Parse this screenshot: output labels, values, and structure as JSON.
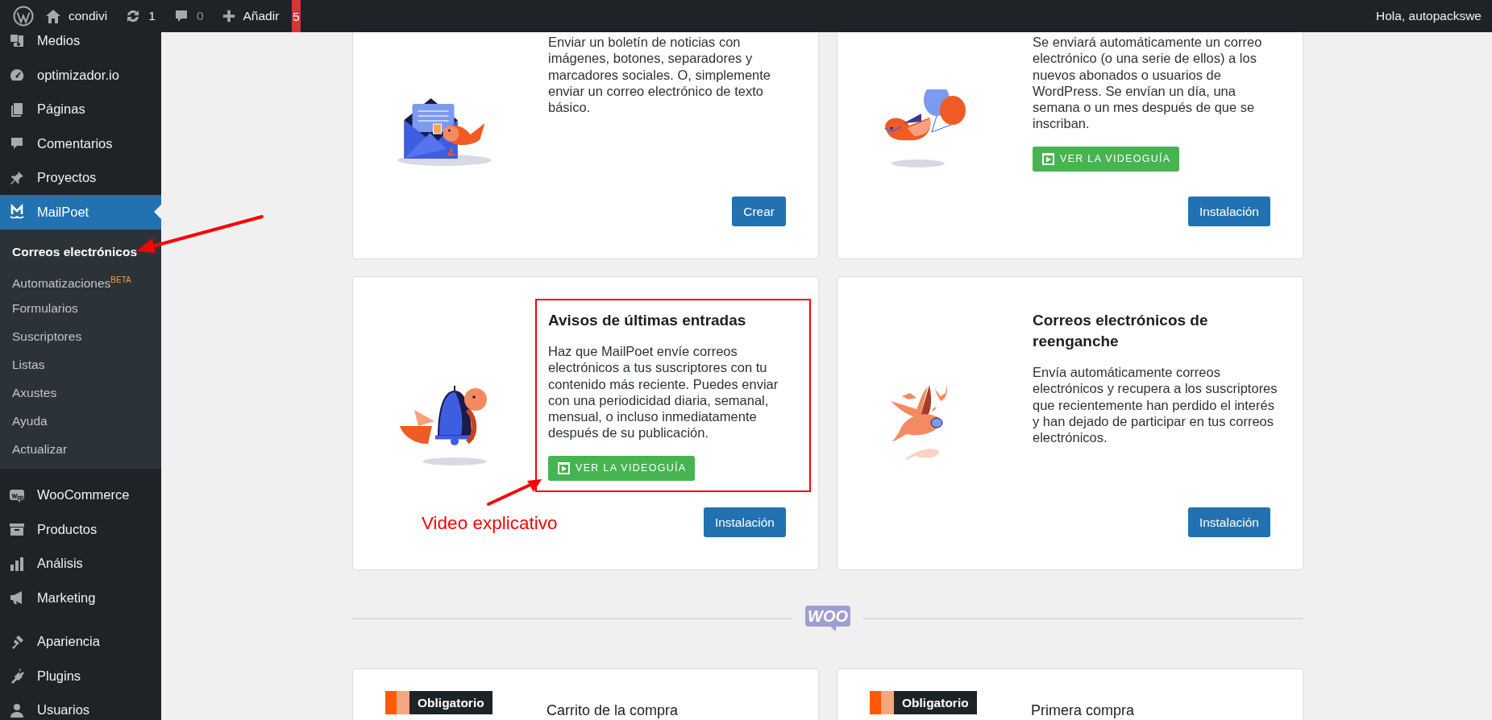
{
  "admin_bar": {
    "site_name": "condivi",
    "updates": "1",
    "comments": "0",
    "add_new": "Añadir",
    "notification": "5",
    "greeting": "Hola, autopackswe"
  },
  "sidebar": {
    "groups": [
      {
        "items": [
          {
            "label": "Medios",
            "selected": false
          },
          {
            "label": "optimizador.io",
            "selected": false
          },
          {
            "label": "Páginas",
            "selected": false
          },
          {
            "label": "Comentarios",
            "selected": false
          },
          {
            "label": "Proyectos",
            "selected": false
          },
          {
            "label": "MailPoet",
            "selected": true,
            "children": [
              {
                "label": "Correos electrónicos",
                "selected": true,
                "pointed_at": true
              },
              {
                "label": "Automatizaciones$^{BETA}$",
                "selected": false,
                "pointed_at": false
              },
              {
                "label": "Formularios",
                "selected": false,
                "pointed_at": false
              },
              {
                "label": "Suscriptores",
                "selected": false,
                "pointed_at": false
              },
              {
                "label": "Listas",
                "selected": false,
                "pointed_at": false
              },
              {
                "label": "Axustes",
                "selected": false,
                "pointed_at": false
              },
              {
                "label": "Ayuda",
                "selected": false,
                "pointed_at": false
              },
              {
                "label": "Actualizar",
                "selected": false,
                "pointed_at": false
              }
            ]
          }
        ]
      },
      {
        "items": [
          {
            "label": "WooCommerce",
            "selected": false
          },
          {
            "label": "Productos",
            "selected": false
          },
          {
            "label": "Análisis",
            "selected": false
          },
          {
            "label": "Marketing",
            "selected": false
          }
        ]
      },
      {
        "items": [
          {
            "label": "Apariencia",
            "selected": false
          },
          {
            "label": "Plugins",
            "selected": false
          },
          {
            "label": "Usuarios",
            "selected": false
          }
        ]
      }
    ]
  },
  "cards": [
    {
      "description": "Enviar un boletín de noticias con imágenes, botones, separadores y marcadores sociales. O, simplemente enviar un correo electrónico de texto básico.",
      "button": "Crear",
      "highlighted": false
    },
    {
      "description": "Se enviará automáticamente un correo electrónico (o una serie de ellos) a los nuevos abonados o usuarios de WordPress. Se envían un día, una semana o un mes después de que se inscriban.",
      "video_button": "VER LA VIDEOGUÍA",
      "button": "Instalación",
      "highlighted": false
    },
    {
      "title": "Avisos de últimas entradas",
      "description": "Haz que MailPoet envíe correos electrónicos a tus suscriptores con tu contenido más reciente. Puedes enviar con una periodicidad diaria, semanal, mensual, o incluso inmediatamente después de su publicación.",
      "video_button": "VER LA VIDEOGUÍA",
      "button": "Instalación",
      "highlighted": true,
      "note": "Video explicativo"
    },
    {
      "title": "Correos electrónicos de reenganche",
      "description": "Envía automáticamente correos electrónicos y recupera a los suscriptores que recientemente han perdido el interés y han dejado de participar en tus correos electrónicos.",
      "button": "Instalación",
      "highlighted": false
    }
  ],
  "woo_logo": "WOO",
  "woo_cards": [
    {
      "badge": "Obligatorio",
      "title": "Carrito de la compra"
    },
    {
      "badge": "Obligatorio",
      "title": "Primera compra"
    }
  ]
}
